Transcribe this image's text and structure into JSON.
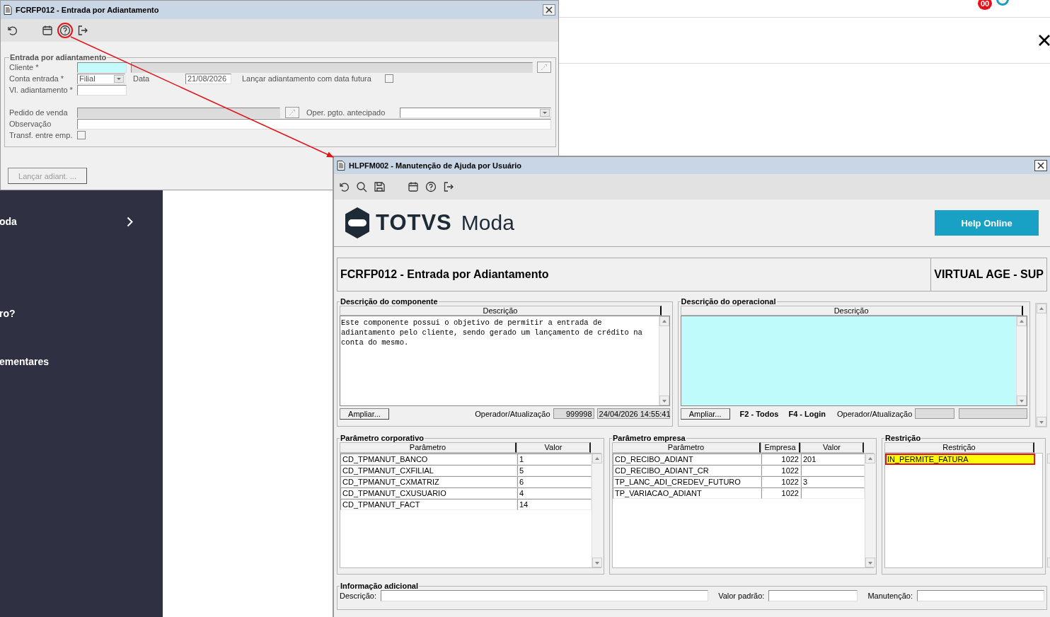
{
  "page": {
    "badge": "00",
    "sidebar": [
      {
        "label": "oda",
        "has_chevron": true
      },
      {
        "label": "ro?",
        "has_chevron": false
      },
      {
        "label": "ementares",
        "has_chevron": false
      }
    ]
  },
  "form_window": {
    "title": "FCRFP012 - Entrada por Adiantamento",
    "toolbar": [
      [
        {
          "kind": "undo",
          "highlighted": false
        }
      ],
      [
        {
          "kind": "calendar",
          "highlighted": false
        },
        {
          "kind": "help",
          "highlighted": true
        },
        {
          "kind": "exit",
          "highlighted": false
        }
      ]
    ],
    "group_title": "Entrada por adiantamento",
    "cliente": {
      "label": "Cliente *"
    },
    "conta_entrada": {
      "label": "Conta entrada *",
      "value": "Filial"
    },
    "data": {
      "label": "Data",
      "value": "21/08/2026"
    },
    "data_futura": {
      "label": "Lançar adiantamento com data futura",
      "checked": false
    },
    "vl_adiantamento": {
      "label": "Vl. adiantamento *"
    },
    "pedido_venda": {
      "label": "Pedido de venda",
      "disabled": true
    },
    "oper_pgto": {
      "label": "Oper. pgto. antecipado"
    },
    "observacao": {
      "label": "Observação"
    },
    "transf": {
      "label": "Transf. entre emp.",
      "checked": false
    },
    "button": {
      "label": "Lançar adiant. ...",
      "disabled": true
    }
  },
  "help_window": {
    "title": "HLPFM002 - Manutenção de Ajuda por Usuário",
    "toolbar": [
      [
        {
          "kind": "undo",
          "highlighted": false
        },
        {
          "kind": "search",
          "highlighted": false
        },
        {
          "kind": "save",
          "highlighted": false
        }
      ],
      [
        {
          "kind": "calendar",
          "highlighted": false
        },
        {
          "kind": "help",
          "highlighted": false
        },
        {
          "kind": "exit",
          "highlighted": false
        }
      ]
    ],
    "logo": {
      "brand": "TOTVS",
      "product": "Moda"
    },
    "help_online": "Help Online",
    "header": {
      "title": "FCRFP012 - Entrada por Adiantamento",
      "company": "VIRTUAL AGE - SUP"
    },
    "componente": {
      "title": "Descrição do componente",
      "column": "Descrição",
      "text": "Este componente possui o objetivo de permitir a entrada de adiantamento pelo cliente, sendo gerado um lançamento de crédito na conta do mesmo.",
      "button": "Ampliar...",
      "operator_label": "Operador/Atualização",
      "operator": "999998",
      "updated": "24/04/2026 14:55:41"
    },
    "operacional": {
      "title": "Descrição do operacional",
      "column": "Descrição",
      "button": "Ampliar...",
      "hints": [
        "F2 - Todos",
        "F4 - Login"
      ],
      "operator_label": "Operador/Atualização"
    },
    "tables": [
      {
        "title": "Parâmetro corporativo",
        "columns": [
          "Parâmetro",
          "Valor"
        ],
        "rows": [
          {
            "cells": [
              "CD_TPMANUT_BANCO",
              "1"
            ],
            "selected": false
          },
          {
            "cells": [
              "CD_TPMANUT_CXFILIAL",
              "5"
            ],
            "selected": false
          },
          {
            "cells": [
              "CD_TPMANUT_CXMATRIZ",
              "6"
            ],
            "selected": false
          },
          {
            "cells": [
              "CD_TPMANUT_CXUSUARIO",
              "4"
            ],
            "selected": false
          },
          {
            "cells": [
              "CD_TPMANUT_FACT",
              "14"
            ],
            "selected": false
          }
        ]
      },
      {
        "title": "Parâmetro empresa",
        "columns": [
          "Parâmetro",
          "Empresa",
          "Valor"
        ],
        "rows": [
          {
            "cells": [
              "CD_RECIBO_ADIANT",
              "1022",
              "201"
            ],
            "selected": false
          },
          {
            "cells": [
              "CD_RECIBO_ADIANT_CR",
              "1022",
              null
            ],
            "selected": false
          },
          {
            "cells": [
              "TP_LANC_ADI_CREDEV_FUTURO",
              "1022",
              "3"
            ],
            "selected": false
          },
          {
            "cells": [
              "TP_VARIACAO_ADIANT",
              "1022",
              null
            ],
            "selected": false
          }
        ]
      },
      {
        "title": "Restrição",
        "columns": [
          "Restrição"
        ],
        "rows": [
          {
            "cells": [
              "IN_PERMITE_FATURA"
            ],
            "selected": true
          }
        ]
      }
    ],
    "info": {
      "title": "Informação adicional",
      "fields": [
        "Descrição:",
        "Valor padrão:",
        "Manutenção:"
      ]
    }
  }
}
